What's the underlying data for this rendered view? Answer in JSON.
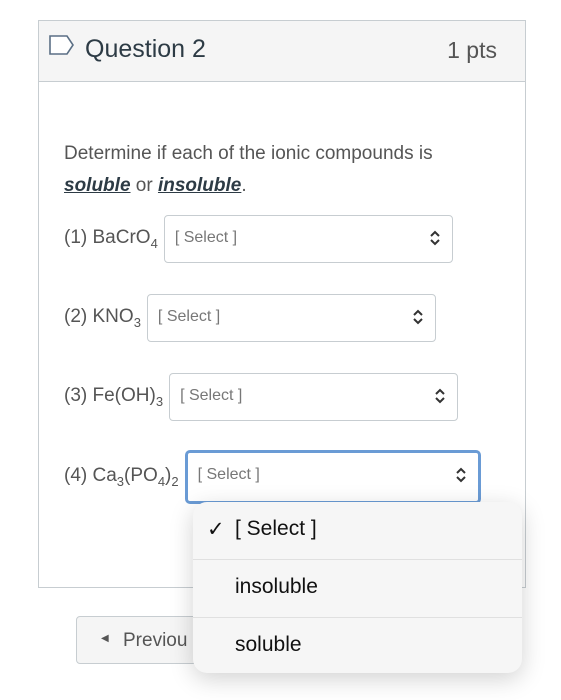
{
  "question": {
    "title": "Question 2",
    "points": "1 pts",
    "prompt_start": "Determine if each of the ionic compounds is",
    "word_soluble": "soluble",
    "word_or": " or ",
    "word_insoluble": "insoluble",
    "period": "."
  },
  "items": [
    {
      "num": "(1) ",
      "formula": [
        "BaCrO",
        "4",
        "",
        "",
        ""
      ],
      "value": "[ Select ]"
    },
    {
      "num": "(2) ",
      "formula": [
        "KNO",
        "3",
        "",
        "",
        ""
      ],
      "value": "[ Select ]"
    },
    {
      "num": "(3) ",
      "formula": [
        "Fe(OH)",
        "3",
        "",
        "",
        ""
      ],
      "value": "[ Select ]"
    },
    {
      "num": "(4) ",
      "formula": [
        "Ca",
        "3",
        "(PO",
        "4",
        ")",
        "2"
      ],
      "value": "[ Select ]"
    }
  ],
  "dropdown": {
    "options": [
      {
        "label": "[ Select ]",
        "checked": true,
        "check": "✓"
      },
      {
        "label": "insoluble",
        "checked": false
      },
      {
        "label": "soluble",
        "checked": false
      }
    ]
  },
  "nav": {
    "previous_label": "Previou",
    "previous_icon": "◀"
  }
}
